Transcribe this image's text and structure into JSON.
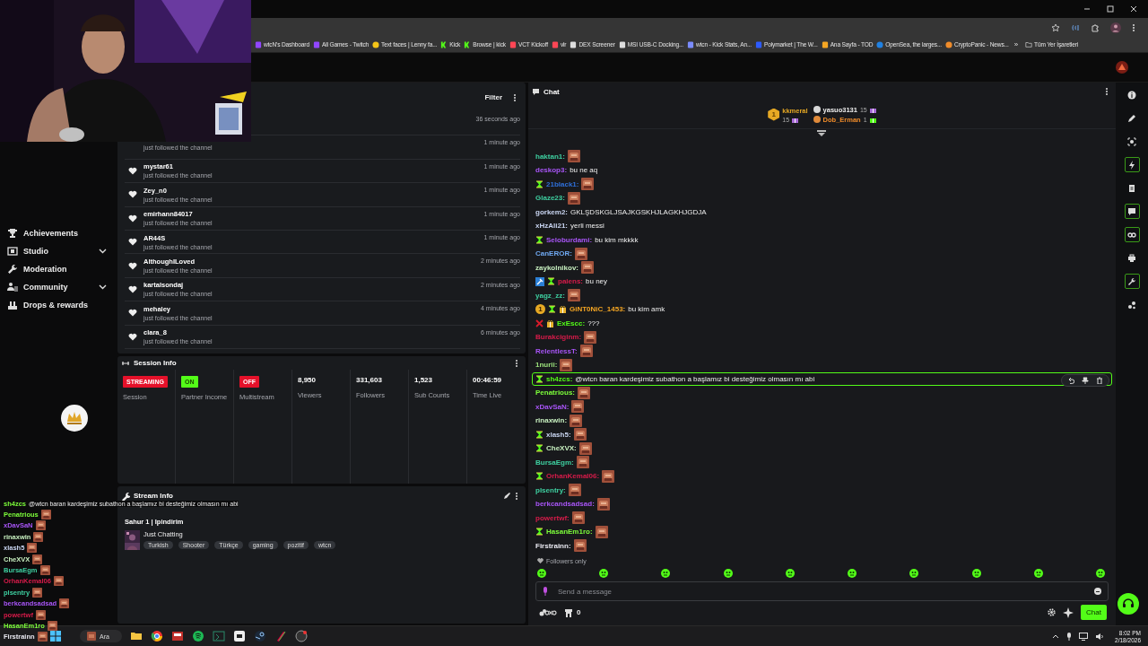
{
  "browser": {
    "bookmarks": [
      {
        "label": "wtcN's Dashboard",
        "kind": "twitch"
      },
      {
        "label": "All Games - Twitch",
        "kind": "twitch"
      },
      {
        "label": "Text faces | Lenny fa...",
        "kind": "smile"
      },
      {
        "label": "Kick",
        "kind": "kick"
      },
      {
        "label": "Browse | kick",
        "kind": "kick"
      },
      {
        "label": "VCT Kickoff",
        "kind": "valorant"
      },
      {
        "label": "vlr",
        "kind": "valorant"
      },
      {
        "label": "DEX Screener",
        "kind": "dex"
      },
      {
        "label": "MSI USB-C Docking...",
        "kind": "msi"
      },
      {
        "label": "wtcn - Kick Stats, An...",
        "kind": "stats"
      },
      {
        "label": "Polymarket | The W...",
        "kind": "poly"
      },
      {
        "label": "Ana Sayfa - TOD",
        "kind": "tod"
      },
      {
        "label": "OpenSea, the larges...",
        "kind": "opensea"
      },
      {
        "label": "CryptoPanic - News...",
        "kind": "crypto"
      }
    ],
    "more": "»",
    "all_bookmarks": "Tüm Yer İşaretleri"
  },
  "sidebar": {
    "items": [
      {
        "label": "Achievements",
        "kind": "trophy",
        "expandable": false
      },
      {
        "label": "Studio",
        "kind": "studio",
        "expandable": true
      },
      {
        "label": "Moderation",
        "kind": "wrench",
        "expandable": false
      },
      {
        "label": "Community",
        "kind": "people",
        "expandable": true
      },
      {
        "label": "Drops & rewards",
        "kind": "drops",
        "expandable": false
      }
    ]
  },
  "activity": {
    "filter": "Filter",
    "events": [
      {
        "time": "36 seconds ago"
      },
      {
        "description": "just followed the channel",
        "time": "1 minute ago"
      },
      {
        "name": "mystar61",
        "description": "just followed the channel",
        "time": "1 minute ago"
      },
      {
        "name": "Zey_n0",
        "description": "just followed the channel",
        "time": "1 minute ago"
      },
      {
        "name": "emirhann84017",
        "description": "just followed the channel",
        "time": "1 minute ago"
      },
      {
        "name": "AR44S",
        "description": "just followed the channel",
        "time": "1 minute ago"
      },
      {
        "name": "AlthoughILoved",
        "description": "just followed the channel",
        "time": "2 minutes ago"
      },
      {
        "name": "kartalsondaj",
        "description": "just followed the channel",
        "time": "2 minutes ago"
      },
      {
        "name": "mehaley",
        "description": "just followed the channel",
        "time": "4 minutes ago"
      },
      {
        "name": "clara_8",
        "description": "just followed the channel",
        "time": "6 minutes ago"
      }
    ]
  },
  "session_info": {
    "title": "Session Info",
    "stats": [
      {
        "kind": "badge",
        "value": "STREAMING",
        "label": "Session",
        "color": "#e5112a"
      },
      {
        "kind": "badge",
        "value": "ON",
        "label": "Partner Income",
        "color": "#53fc18"
      },
      {
        "kind": "badge",
        "value": "OFF",
        "label": "Multistream",
        "color": "#e5112a"
      },
      {
        "kind": "number",
        "value": "8,950",
        "label": "Viewers"
      },
      {
        "kind": "number",
        "value": "331,603",
        "label": "Followers"
      },
      {
        "kind": "number",
        "value": "1,523",
        "label": "Sub Counts"
      },
      {
        "kind": "number",
        "value": "00:46:59",
        "label": "Time Live"
      }
    ]
  },
  "stream_info": {
    "title": "Stream Info",
    "stream_title": "Sahur 1 | Ipindirim",
    "category": "Just Chatting",
    "tags": [
      "Turkish",
      "Shooter",
      "Türkçe",
      "gaming",
      "pozitif",
      "wtcn"
    ]
  },
  "chat": {
    "title": "Chat",
    "leaderboard": [
      {
        "rank": "1",
        "name": "kkmeral",
        "count": "15"
      },
      {
        "name": "yasuo3131",
        "count": "15"
      },
      {
        "name": "Dob_Erman",
        "count": "1"
      }
    ],
    "messages": [
      {
        "name": "haktan1:",
        "color": "#3ecfa0",
        "kind": "emote",
        "highlighted": false
      },
      {
        "name": "deskop3:",
        "color": "#a855f7",
        "kind": "text",
        "text": "bu ne aq",
        "highlighted": false
      },
      {
        "name": "21black1:",
        "color": "#2f6fd8",
        "kind": "emote",
        "badges": [
          {
            "kind": "hourglass"
          }
        ],
        "highlighted": false
      },
      {
        "name": "Glaze23:",
        "color": "#3ecfa0",
        "kind": "emote",
        "highlighted": false
      },
      {
        "name": "gorkem2:",
        "color": "#c8d4f0",
        "kind": "text",
        "text": "GKLŞDSKGLJSAJKGSKHJLAGKHJGDJA",
        "highlighted": false
      },
      {
        "name": "xHzAli21:",
        "color": "#c8d4f0",
        "kind": "text",
        "text": "yerli messi",
        "highlighted": false
      },
      {
        "name": "Seloburdami:",
        "color": "#a855f7",
        "kind": "text",
        "text": "bu kim mkkkk",
        "badges": [
          {
            "kind": "hourglass"
          }
        ],
        "highlighted": false
      },
      {
        "name": "CanEROR:",
        "color": "#6fa8f0",
        "kind": "emote",
        "highlighted": false
      },
      {
        "name": "zaykolnikov:",
        "color": "#c8f0c0",
        "kind": "emote",
        "highlighted": false
      },
      {
        "name": "paiens:",
        "color": "#d81b4a",
        "kind": "text",
        "text": "bu ney",
        "badges": [
          {
            "kind": "hammer"
          },
          {
            "kind": "hourglass"
          }
        ],
        "highlighted": false
      },
      {
        "name": "yagz_zz:",
        "color": "#3ecfa0",
        "kind": "emote",
        "highlighted": false
      },
      {
        "name": "GiNT0NiC_1453:",
        "color": "#f5a623",
        "kind": "text",
        "text": "bu kim amk",
        "badges": [
          {
            "kind": "rank",
            "text": "1"
          },
          {
            "kind": "hourglass"
          },
          {
            "kind": "gift"
          }
        ],
        "highlighted": false
      },
      {
        "name": "ExEscc:",
        "color": "#53fc18",
        "kind": "text",
        "text": "???",
        "badges": [
          {
            "kind": "sword"
          },
          {
            "kind": "gift"
          }
        ],
        "highlighted": false
      },
      {
        "name": "Burakciginm:",
        "color": "#d81b4a",
        "kind": "emote",
        "highlighted": false
      },
      {
        "name": "RelentlessT:",
        "color": "#a855f7",
        "kind": "emote",
        "highlighted": false
      },
      {
        "name": "1nurii:",
        "color": "#9de37d",
        "kind": "emote",
        "highlighted": false
      },
      {
        "name": "sh4zcs:",
        "color": "#53fc18",
        "kind": "text",
        "text": "@wtcn baran kardeşimiz subathon a başlamız bi desteğimiz olmasın mı abi",
        "badges": [
          {
            "kind": "hourglass"
          }
        ],
        "highlighted": true
      },
      {
        "name": "Penatrious:",
        "color": "#7cfc3a",
        "kind": "emote",
        "highlighted": false
      },
      {
        "name": "xDavSaN:",
        "color": "#a855f7",
        "kind": "emote",
        "highlighted": false
      },
      {
        "name": "rinaxwin:",
        "color": "#c8f0c0",
        "kind": "emote",
        "highlighted": false
      },
      {
        "name": "xlash5:",
        "color": "#c8d4f0",
        "kind": "emote",
        "badges": [
          {
            "kind": "hourglass"
          }
        ],
        "highlighted": false
      },
      {
        "name": "CheXVX:",
        "color": "#c8f0c0",
        "kind": "emote",
        "badges": [
          {
            "kind": "hourglass"
          }
        ],
        "highlighted": false
      },
      {
        "name": "BursaEgm:",
        "color": "#3ecfa0",
        "kind": "emote",
        "highlighted": false
      },
      {
        "name": "OrhanKemal06:",
        "color": "#d81b4a",
        "kind": "emote",
        "badges": [
          {
            "kind": "hourglass"
          }
        ],
        "highlighted": false
      },
      {
        "name": "plsentry:",
        "color": "#3ecfa0",
        "kind": "emote",
        "highlighted": false
      },
      {
        "name": "berkcandsadsad:",
        "color": "#a855f7",
        "kind": "emote",
        "highlighted": false
      },
      {
        "name": "powertwf:",
        "color": "#d81b4a",
        "kind": "emote",
        "highlighted": false
      },
      {
        "name": "HasanEm1ro:",
        "color": "#7cfc3a",
        "kind": "emote",
        "badges": [
          {
            "kind": "hourglass"
          }
        ],
        "highlighted": false
      },
      {
        "name": "Firstrainn:",
        "color": "#e8e8f0",
        "kind": "emote",
        "highlighted": false
      }
    ],
    "mode": "Followers only",
    "input": {
      "placeholder": "Send a message"
    },
    "points": "0",
    "send_button": "Chat",
    "rail": [
      {
        "kind": "info",
        "active": false
      },
      {
        "kind": "pencil",
        "active": false
      },
      {
        "kind": "capture",
        "active": false
      },
      {
        "kind": "bolt",
        "active": true
      },
      {
        "kind": "document",
        "active": false
      },
      {
        "kind": "chat",
        "active": true
      },
      {
        "kind": "link",
        "active": true
      },
      {
        "kind": "printer",
        "active": false
      },
      {
        "kind": "wrench",
        "active": true
      },
      {
        "kind": "nodes",
        "active": false
      }
    ]
  },
  "overlay_chat": [
    {
      "name": "sh4zcs",
      "color": "#7cfc3a",
      "kind": "text",
      "text": "@wtcn baran kardeşimiz subathon a başlamız bi desteğimiz olmasın mı abi"
    },
    {
      "name": "Penatrious",
      "color": "#7cfc3a",
      "kind": "emote"
    },
    {
      "name": "xDavSaN",
      "color": "#a855f7",
      "kind": "emote"
    },
    {
      "name": "rinaxwin",
      "color": "#c8f0c0",
      "kind": "emote"
    },
    {
      "name": "xlash5",
      "color": "#c8d4f0",
      "kind": "emote"
    },
    {
      "name": "CheXVX",
      "color": "#c8f0c0",
      "kind": "emote"
    },
    {
      "name": "BursaEgm",
      "color": "#3ecfa0",
      "kind": "emote"
    },
    {
      "name": "OrhanKemal06",
      "color": "#d81b4a",
      "kind": "emote"
    },
    {
      "name": "plsentry",
      "color": "#3ecfa0",
      "kind": "emote"
    },
    {
      "name": "berkcandsadsad",
      "color": "#a855f7",
      "kind": "emote"
    },
    {
      "name": "powertwf",
      "color": "#d81b4a",
      "kind": "emote"
    },
    {
      "name": "HasanEm1ro",
      "color": "#7cfc3a",
      "kind": "emote"
    },
    {
      "name": "Firstrainn",
      "color": "#e8e8f0",
      "kind": "emote"
    }
  ],
  "taskbar": {
    "search": "Ara",
    "time": "8:02 PM",
    "date": "2/18/2026"
  }
}
